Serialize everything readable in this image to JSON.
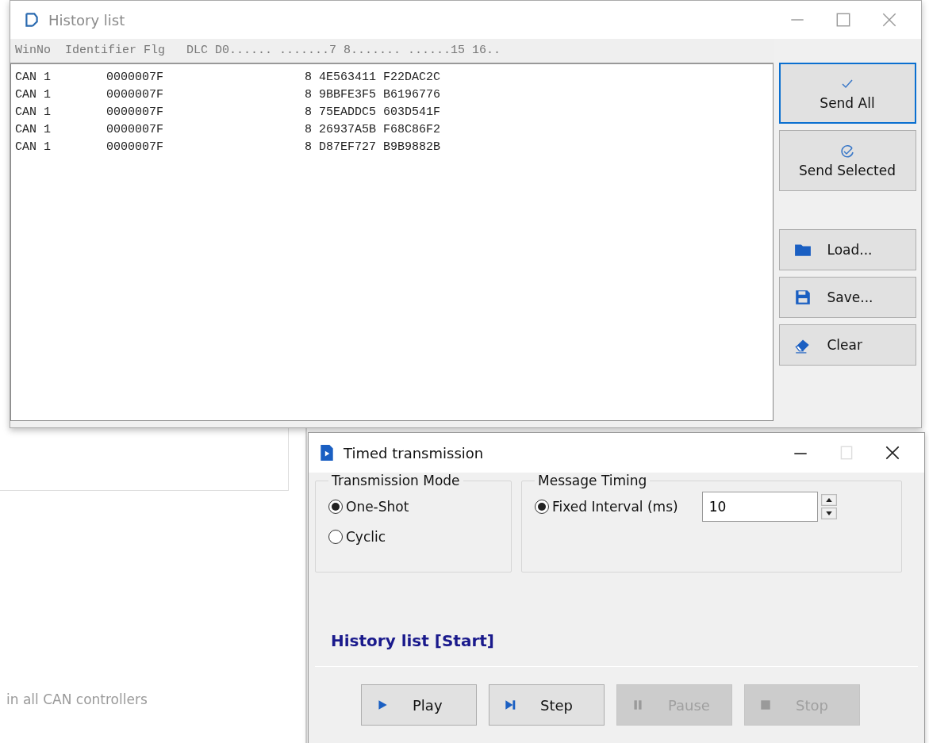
{
  "background_window": {
    "hint": "in all CAN controllers"
  },
  "history_window": {
    "title": "History list",
    "header": "WinNo  Identifier Flg   DLC D0...... .......7 8....... ......15 16..",
    "rows": [
      {
        "winno": "CAN 1",
        "identifier": "0000007F",
        "dlc": "8",
        "data": "4E563411 F22DAC2C"
      },
      {
        "winno": "CAN 1",
        "identifier": "0000007F",
        "dlc": "8",
        "data": "9BBFE3F5 B6196776"
      },
      {
        "winno": "CAN 1",
        "identifier": "0000007F",
        "dlc": "8",
        "data": "75EADDC5 603D541F"
      },
      {
        "winno": "CAN 1",
        "identifier": "0000007F",
        "dlc": "8",
        "data": "26937A5B F68C86F2"
      },
      {
        "winno": "CAN 1",
        "identifier": "0000007F",
        "dlc": "8",
        "data": "D87EF727 B9B9882B"
      }
    ],
    "buttons": [
      {
        "kind": "send-all",
        "label": "Send All",
        "focused": true
      },
      {
        "kind": "send-selected",
        "label": "Send Selected",
        "focused": false
      },
      {
        "kind": "load",
        "label": "Load...",
        "focused": false
      },
      {
        "kind": "save",
        "label": "Save...",
        "focused": false
      },
      {
        "kind": "clear",
        "label": "Clear",
        "focused": false
      }
    ]
  },
  "timed_window": {
    "title": "Timed transmission",
    "transmission_mode": {
      "label": "Transmission Mode",
      "options": [
        {
          "label": "One-Shot",
          "selected": true
        },
        {
          "label": "Cyclic",
          "selected": false
        }
      ]
    },
    "message_timing": {
      "label": "Message Timing",
      "option": {
        "label": "Fixed Interval (ms)",
        "selected": true
      },
      "value": "10"
    },
    "status": "History list [Start]",
    "buttons": [
      {
        "kind": "play",
        "label": "Play",
        "disabled": false
      },
      {
        "kind": "step",
        "label": "Step",
        "disabled": false
      },
      {
        "kind": "pause",
        "label": "Pause",
        "disabled": true
      },
      {
        "kind": "stop",
        "label": "Stop",
        "disabled": true
      }
    ]
  }
}
